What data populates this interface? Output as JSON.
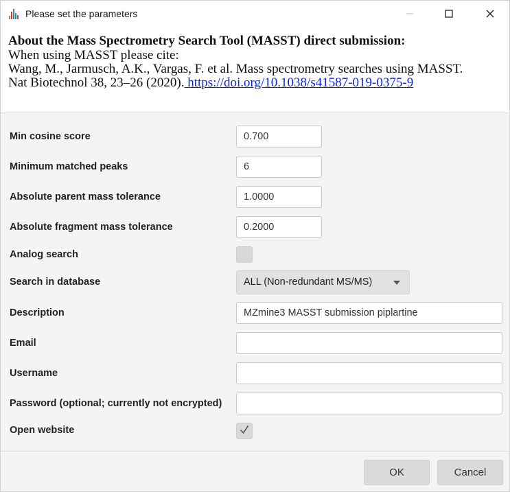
{
  "window": {
    "title": "Please set the parameters"
  },
  "header": {
    "title": "About the Mass Spectrometry Search Tool (MASST) direct submission:",
    "line1": "When using MASST please cite:",
    "line2": "Wang, M., Jarmusch, A.K., Vargas, F. et al. Mass spectrometry searches using MASST.",
    "line3_prefix": "Nat Biotechnol 38, 23–26 (2020).",
    "line3_link": " https://doi.org/10.1038/s41587-019-0375-9"
  },
  "form": {
    "min_cosine": {
      "label": "Min cosine score",
      "value": "0.700"
    },
    "min_peaks": {
      "label": "Minimum matched peaks",
      "value": "6"
    },
    "parent_tol": {
      "label": "Absolute parent mass tolerance",
      "value": "1.0000"
    },
    "fragment_tol": {
      "label": "Absolute fragment mass tolerance",
      "value": "0.2000"
    },
    "analog": {
      "label": "Analog search",
      "checked": false
    },
    "database": {
      "label": "Search in database",
      "selected": "ALL (Non-redundant MS/MS)"
    },
    "description": {
      "label": "Description",
      "value": "MZmine3 MASST submission piplartine"
    },
    "email": {
      "label": "Email",
      "value": ""
    },
    "username": {
      "label": "Username",
      "value": ""
    },
    "password": {
      "label": "Password (optional; currently not encrypted)",
      "value": ""
    },
    "open_website": {
      "label": "Open website",
      "checked": true
    }
  },
  "footer": {
    "ok_label": "OK",
    "cancel_label": "Cancel"
  },
  "icons": {
    "app": "spectrum-app-icon",
    "minimize": "minimize-icon",
    "maximize": "maximize-icon",
    "close": "close-icon",
    "dropdown": "chevron-down-icon",
    "check": "checkmark-icon"
  }
}
